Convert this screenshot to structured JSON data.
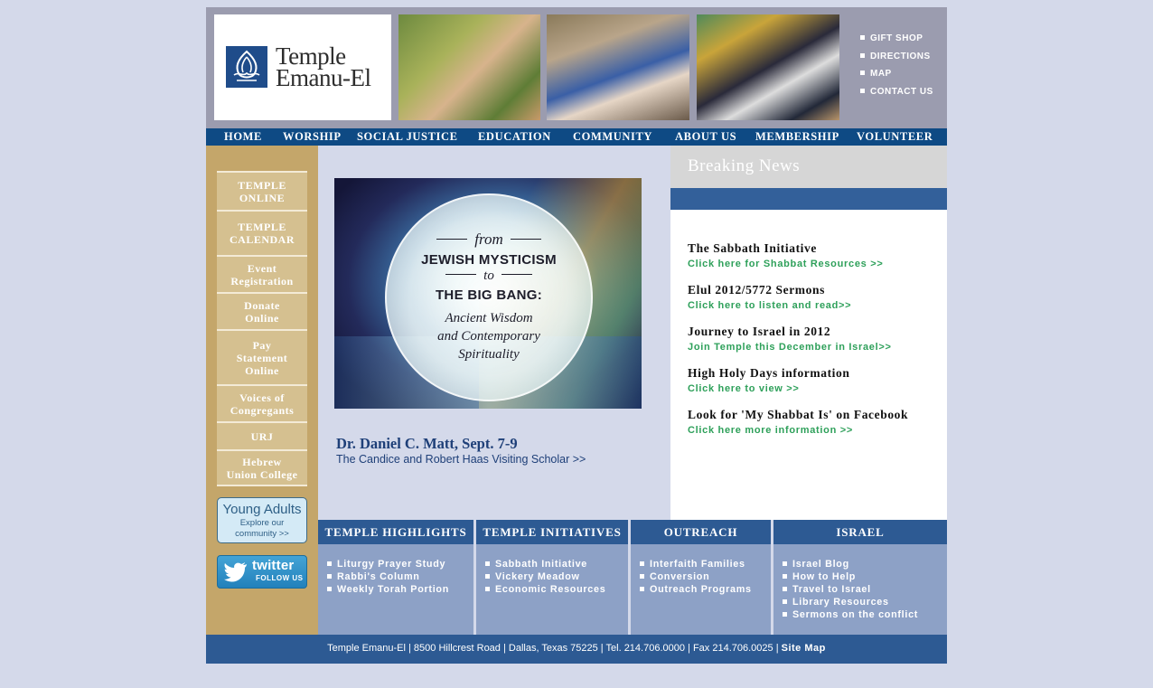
{
  "colors": {
    "page_background": "#d4d9ea",
    "nav_blue": "#0e4a84",
    "box_blue": "#2d5a93",
    "left_column_tan": "#c4a66a",
    "link_green": "#2ea05a"
  },
  "header": {
    "logo": {
      "line1": "Temple",
      "line2": "Emanu-El",
      "icon": "temple-emanu-el-logo-icon"
    },
    "top_links": [
      "GIFT SHOP",
      "DIRECTIONS",
      "MAP",
      "CONTACT US"
    ]
  },
  "nav": [
    "HOME",
    "WORSHIP",
    "SOCIAL JUSTICE",
    "EDUCATION",
    "COMMUNITY",
    "ABOUT US",
    "MEMBERSHIP",
    "VOLUNTEER"
  ],
  "sidebar": {
    "items": [
      {
        "line1": "TEMPLE",
        "line2": "ONLINE"
      },
      {
        "line1": "TEMPLE",
        "line2": "CALENDAR"
      },
      {
        "line1": "Event",
        "line2": "Registration"
      },
      {
        "line1": "Donate",
        "line2": "Online"
      },
      {
        "line1": "Pay",
        "line2": "Statement",
        "line3": "Online"
      },
      {
        "line1": "Voices of",
        "line2": "Congregants"
      },
      {
        "line1": "URJ"
      },
      {
        "line1": "Hebrew",
        "line2": "Union College"
      }
    ],
    "young_adults": {
      "title": "Young Adults",
      "sub1": "Explore our",
      "sub2": "community >>"
    },
    "twitter": {
      "word": "twitter",
      "follow": "FOLLOW US",
      "icon": "twitter-bird-icon"
    }
  },
  "feature": {
    "from": "from",
    "title1": "JEWISH MYSTICISM",
    "to": "to",
    "title2": "THE BIG BANG:",
    "sub1": "Ancient Wisdom",
    "sub2": "and Contemporary",
    "sub3": "Spirituality",
    "speaker": "Dr. Daniel C. Matt, Sept. 7-9",
    "scholar": "The Candice and Robert Haas Visiting Scholar >>"
  },
  "news": {
    "heading": "Breaking News",
    "items": [
      {
        "title": "The Sabbath Initiative",
        "link": "Click here for Shabbat Resources >>"
      },
      {
        "title": "Elul 2012/5772 Sermons",
        "link": "Click here to listen and read>>"
      },
      {
        "title": "Journey to Israel in 2012",
        "link": "Join Temple this December in Israel>>"
      },
      {
        "title": "High Holy Days information",
        "link": "Click here to view >>"
      },
      {
        "title": "Look for 'My Shabbat Is' on Facebook",
        "link": "Click here more information >>"
      }
    ]
  },
  "boxes": [
    {
      "title": "TEMPLE HIGHLIGHTS",
      "items": [
        "Liturgy Prayer Study",
        "Rabbi's Column",
        "Weekly Torah Portion"
      ]
    },
    {
      "title": "TEMPLE INITIATIVES",
      "items": [
        "Sabbath Initiative",
        "Vickery Meadow",
        "Economic Resources"
      ]
    },
    {
      "title": "OUTREACH",
      "items": [
        "Interfaith Families",
        "Conversion",
        "Outreach Programs"
      ]
    },
    {
      "title": "ISRAEL",
      "items": [
        "Israel Blog",
        "How to Help",
        "Travel to Israel",
        "Library Resources",
        "Sermons on the conflict"
      ]
    }
  ],
  "footer": {
    "text": "Temple Emanu-El | 8500 Hillcrest Road | Dallas, Texas 75225 | Tel. 214.706.0000 | Fax 214.706.0025 | ",
    "site_map": "Site Map"
  }
}
